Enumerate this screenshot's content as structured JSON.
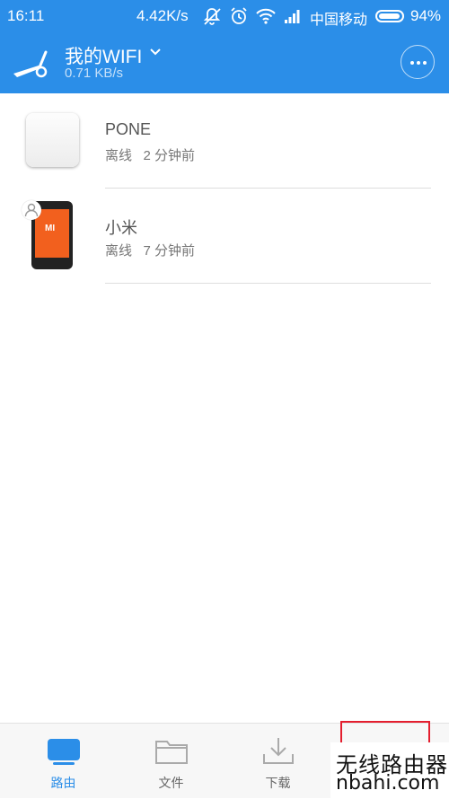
{
  "status_bar": {
    "time": "16:11",
    "net_speed": "4.42K/s",
    "carrier": "中国移动",
    "battery_percent": "94%",
    "battery_level": 0.94
  },
  "header": {
    "title": "我的WIFI",
    "speed": "0.71 KB/s"
  },
  "devices": [
    {
      "name": "PONE",
      "status": "离线",
      "last_seen": "2 分钟前",
      "icon": "router-box-icon"
    },
    {
      "name": "小米",
      "status": "离线",
      "last_seen": "7 分钟前",
      "icon": "xiaomi-phone-icon"
    }
  ],
  "phone_brand_text": "MI",
  "tabs": [
    {
      "label": "路由",
      "icon": "router-tv-icon",
      "active": true
    },
    {
      "label": "文件",
      "icon": "folder-icon",
      "active": false
    },
    {
      "label": "下载",
      "icon": "download-icon",
      "active": false
    }
  ],
  "watermark": {
    "cn": "无线路由器",
    "en": "nbahi.com"
  },
  "colors": {
    "primary": "#2b8ee8",
    "highlight_border": "#e41e2e",
    "phone_screen": "#f2601e"
  }
}
